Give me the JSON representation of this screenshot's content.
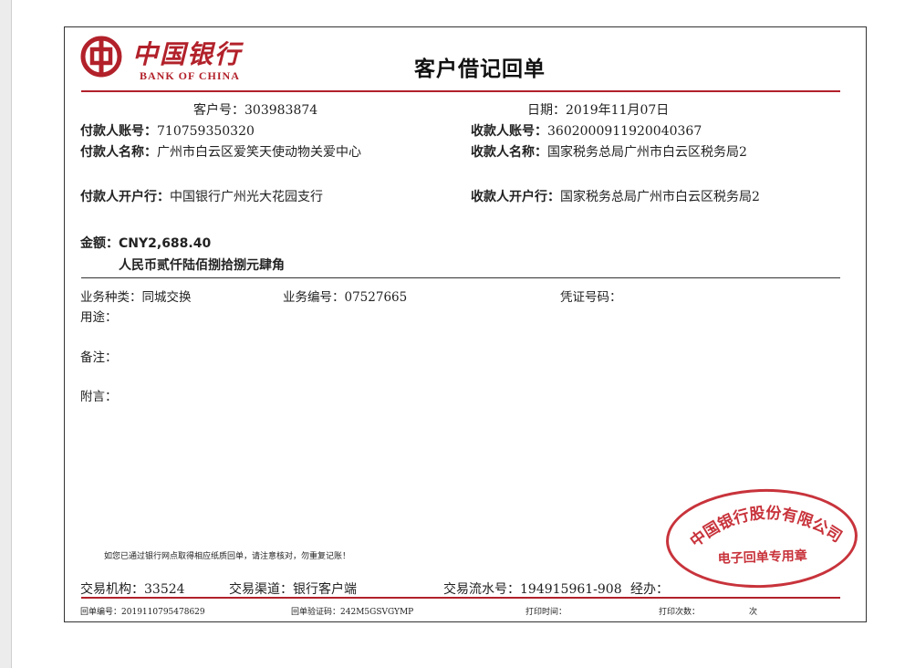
{
  "bank": {
    "name_cn": "中国银行",
    "name_en": "BANK OF CHINA",
    "brand_color": "#b2212a"
  },
  "title": "客户借记回单",
  "customer_no": {
    "label": "客户号：",
    "value": "303983874"
  },
  "date": {
    "label": "日期：",
    "value": "2019年11月07日"
  },
  "payer": {
    "account_label": "付款人账号：",
    "account_value": "710759350320",
    "name_label": "付款人名称：",
    "name_value": "广州市白云区爱笑天使动物关爱中心",
    "bank_label": "付款人开户行：",
    "bank_value": "中国银行广州光大花园支行"
  },
  "payee": {
    "account_label": "收款人账号：",
    "account_value": "3602000911920040367",
    "name_label": "收款人名称：",
    "name_value": "国家税务总局广州市白云区税务局2",
    "bank_label": "收款人开户行：",
    "bank_value": "国家税务总局广州市白云区税务局2"
  },
  "amount": {
    "label": "金额：",
    "value": "CNY2,688.40",
    "in_words": "人民币贰仟陆佰捌拾捌元肆角"
  },
  "business": {
    "type_label": "业务种类：",
    "type_value": "同城交换",
    "number_label": "业务编号：",
    "number_value": "07527665",
    "voucher_label": "凭证号码：",
    "voucher_value": ""
  },
  "purpose_label": "用途：",
  "remark_label": "备注：",
  "postscript_label": "附言：",
  "notice": "如您已通过银行网点取得相应纸质回单，请注意核对，勿重复记账！",
  "stamp": {
    "arc_text": "中国银行股份有限公司",
    "sub_text": "电子回单专用章",
    "color": "#c8333b"
  },
  "footer": {
    "org_label": "交易机构：",
    "org_value": "33524",
    "channel_label": "交易渠道：",
    "channel_value": "银行客户端",
    "serial_label": "交易流水号：",
    "serial_value": "194915961-908",
    "handler_label": "经办："
  },
  "bottom": {
    "receipt_no_label": "回单编号：",
    "receipt_no_value": "2019110795478629",
    "verify_label": "回单验证码：",
    "verify_value": "242M5GSVGYMP",
    "print_time_label": "打印时间：",
    "print_count_label": "打印次数：",
    "print_count_unit": "次"
  }
}
